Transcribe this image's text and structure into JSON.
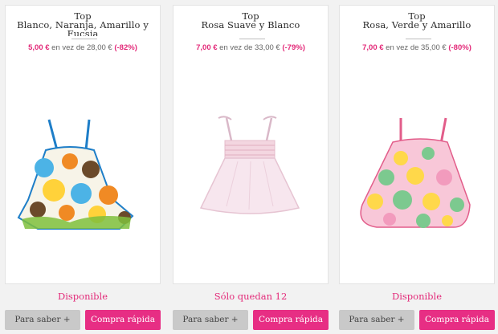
{
  "colors": {
    "accent": "#e72e84",
    "price_pink": "#e32a79",
    "button_grey": "#c9c9c9"
  },
  "products": [
    {
      "title_line1": "Top",
      "title_line2": "Blanco, Naranja, Amarillo y",
      "title_line3": "Fucsia",
      "sale_price": "5,00 €",
      "price_text": " en vez de 28,00 € ",
      "discount": " (-82%)",
      "status": "Disponible",
      "more_label": "Para saber +",
      "quick_label": "Compra rápida"
    },
    {
      "title_line1": "Top",
      "title_line2": "Rosa Suave y Blanco",
      "title_line3": "",
      "sale_price": "7,00 €",
      "price_text": " en vez de 33,00 € ",
      "discount": " (-79%)",
      "status": "Sólo quedan 12",
      "more_label": "Para saber +",
      "quick_label": "Compra rápida"
    },
    {
      "title_line1": "Top",
      "title_line2": "Rosa, Verde y Amarillo",
      "title_line3": "",
      "sale_price": "7,00 €",
      "price_text": " en vez de 35,00 € ",
      "discount": " (-80%)",
      "status": "Disponible",
      "more_label": "Para saber +",
      "quick_label": "Compra rápida"
    }
  ]
}
